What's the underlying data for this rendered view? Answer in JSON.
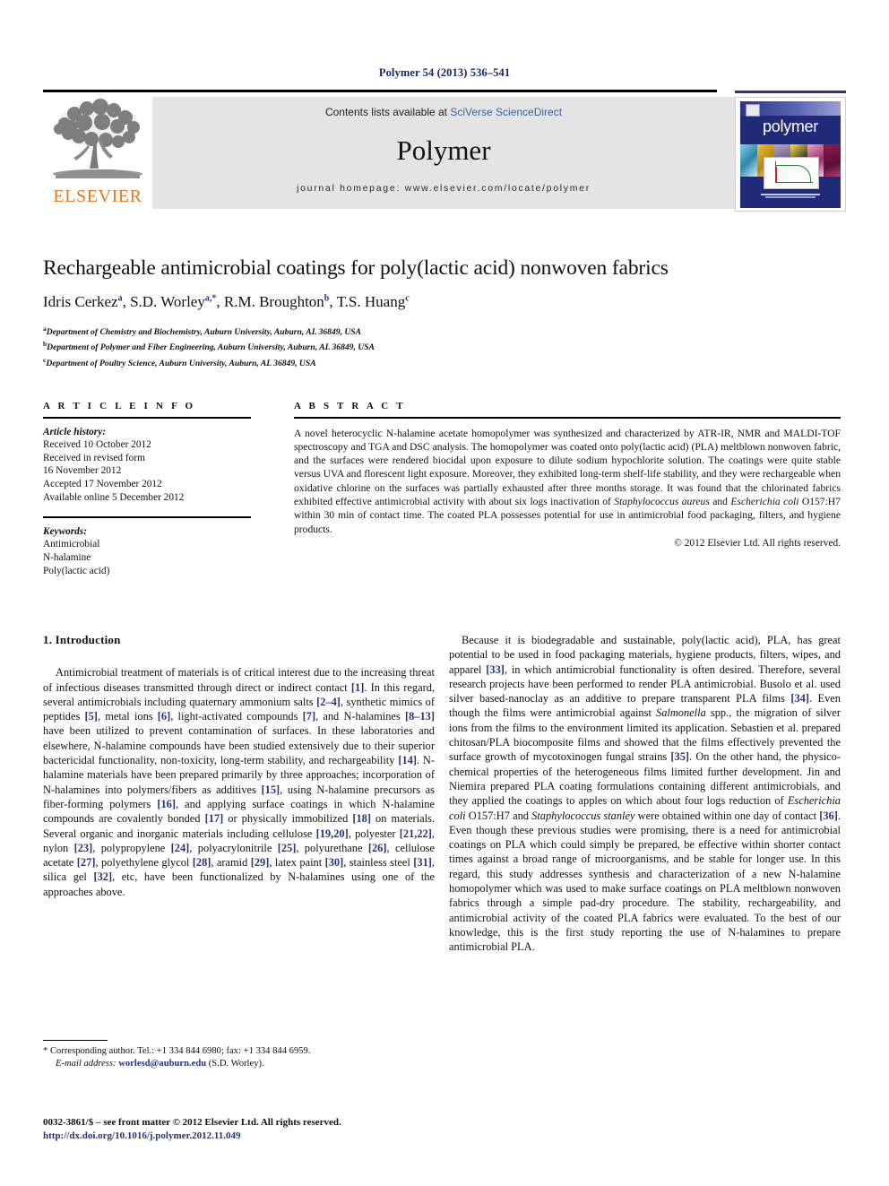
{
  "running_head": "Polymer 54 (2013) 536–541",
  "masthead": {
    "publisher": "ELSEVIER",
    "publisher_logo": "elsevier-tree-logo",
    "contents_prefix": "Contents lists available at ",
    "contents_link": "SciVerse ScienceDirect",
    "journal_name": "Polymer",
    "homepage": "journal homepage: www.elsevier.com/locate/polymer",
    "cover": {
      "title": "polymer",
      "brand_color": "#212a78"
    }
  },
  "article": {
    "title": "Rechargeable antimicrobial coatings for poly(lactic acid) nonwoven fabrics",
    "authors": [
      {
        "name": "Idris Cerkez",
        "marks": "a"
      },
      {
        "name": "S.D. Worley",
        "marks": "a,*"
      },
      {
        "name": "R.M. Broughton",
        "marks": "b"
      },
      {
        "name": "T.S. Huang",
        "marks": "c"
      }
    ],
    "affiliations": [
      {
        "mark": "a",
        "text": "Department of Chemistry and Biochemistry, Auburn University, Auburn, AL 36849, USA"
      },
      {
        "mark": "b",
        "text": "Department of Polymer and Fiber Engineering, Auburn University, Auburn, AL 36849, USA"
      },
      {
        "mark": "c",
        "text": "Department of Poultry Science, Auburn University, Auburn, AL 36849, USA"
      }
    ]
  },
  "article_info": {
    "heading": "A R T I C L E   I N F O",
    "history_label": "Article history:",
    "history": [
      "Received 10 October 2012",
      "Received in revised form",
      "16 November 2012",
      "Accepted 17 November 2012",
      "Available online 5 December 2012"
    ],
    "keywords_label": "Keywords:",
    "keywords": [
      "Antimicrobial",
      "N-halamine",
      "Poly(lactic acid)"
    ]
  },
  "abstract": {
    "heading": "A B S T R A C T",
    "paragraph_1": "A novel heterocyclic N-halamine acetate homopolymer was synthesized and characterized by ATR-IR, NMR and MALDI-TOF spectroscopy and TGA and DSC analysis. The homopolymer was coated onto poly(lactic acid) (PLA) meltblown nonwoven fabric, and the surfaces were rendered biocidal upon exposure to dilute sodium hypochlorite solution. The coatings were quite stable versus UVA and florescent light exposure. Moreover, they exhibited long-term shelf-life stability, and they were rechargeable when oxidative chlorine on the surfaces was partially exhausted after three months storage. It was found that the chlorinated fabrics exhibited effective antimicrobial activity with about six logs inactivation of ",
    "italic_1": "Staphylococcus aureus",
    "mid_1": " and ",
    "italic_2": "Escherichia coli",
    "tail_1": " O157:H7 within 30 min of contact time. The coated PLA possesses potential for use in antimicrobial food packaging, filters, and hygiene products.",
    "copyright": "© 2012 Elsevier Ltd. All rights reserved."
  },
  "introduction": {
    "heading": "1. Introduction",
    "left_p1_a": "Antimicrobial treatment of materials is of critical interest due to the increasing threat of infectious diseases transmitted through direct or indirect contact ",
    "left_refs": {
      "r1": "[1]",
      "r2_4": "[2–4]",
      "r5": "[5]",
      "r6": "[6]",
      "r7": "[7]",
      "r8_13": "[8–13]",
      "r14": "[14]",
      "r15": "[15]",
      "r16": "[16]",
      "r17": "[17]",
      "r18": "[18]",
      "r19_20": "[19,20]",
      "r21_22": "[21,22]",
      "r23": "[23]",
      "r24": "[24]",
      "r25": "[25]",
      "r26": "[26]",
      "r27": "[27]",
      "r28": "[28]",
      "r29": "[29]",
      "r30": "[30]",
      "r31": "[31]",
      "r32": "[32]"
    },
    "left_p1_b": ". In this regard, several antimicrobials including quaternary ammonium salts ",
    "left_p1_c": ", synthetic mimics of peptides ",
    "left_p1_d": ", metal ions ",
    "left_p1_e": ", light-activated compounds ",
    "left_p1_f": ", and N-halamines ",
    "left_p1_g": " have been utilized to prevent contamination of surfaces. In these laboratories and elsewhere, N-halamine compounds have been studied extensively due to their superior bactericidal functionality, non-toxicity, long-term stability, and rechargeability ",
    "left_p1_h": ". N-halamine materials have been prepared primarily by three approaches; incorporation of N-halamines into polymers/fibers as additives ",
    "left_p1_i": ", using N-halamine precursors as fiber-forming polymers ",
    "left_p1_j": ", and applying surface coatings in which N-halamine compounds are covalently bonded ",
    "left_p1_k": " or physically immobilized ",
    "left_p1_l": " on materials. Several organic and inorganic materials including cellulose ",
    "left_p1_m": ", polyester ",
    "left_p1_n": ", nylon ",
    "left_p1_o": ", polypropylene ",
    "left_p1_p": ", polyacrylonitrile ",
    "left_p1_q": ", polyurethane ",
    "left_p1_r": ", cellulose acetate ",
    "left_p1_s": ", polyethylene glycol ",
    "left_p1_t": ", aramid ",
    "left_p1_u": ", latex paint ",
    "left_p1_v": ", stainless steel ",
    "left_p1_w": ", silica gel ",
    "left_p1_x": ", etc, have been functionalized by N-halamines using one of the approaches above.",
    "right_refs": {
      "r33": "[33]",
      "r34": "[34]",
      "r35": "[35]",
      "r36": "[36]"
    },
    "right_p1_a": "Because it is biodegradable and sustainable, poly(lactic acid), PLA, has great potential to be used in food packaging materials, hygiene products, filters, wipes, and apparel ",
    "right_p1_b": ", in which antimicrobial functionality is often desired. Therefore, several research projects have been performed to render PLA antimicrobial. Busolo et al. used silver based-nanoclay as an additive to prepare transparent PLA films ",
    "right_p1_c": ". Even though the films were antimicrobial against ",
    "right_italic_1": "Salmonella",
    "right_p1_d": " spp., the migration of silver ions from the films to the environment limited its application. Sebastien et al. prepared chitosan/PLA biocomposite films and showed that the films effectively prevented the surface growth of mycotoxinogen fungal strains ",
    "right_p1_e": ". On the other hand, the physico-chemical properties of the heterogeneous films limited further development. Jin and Niemira prepared PLA coating formulations containing different antimicrobials, and they applied the coatings to apples on which about four logs reduction of ",
    "right_italic_2": "Escherichia coli",
    "right_p1_f": " O157:H7 and ",
    "right_italic_3": "Staphylococcus stanley",
    "right_p1_g": " were obtained within one day of contact ",
    "right_p1_h": ". Even though these previous studies were promising, there is a need for antimicrobial coatings on PLA which could simply be prepared, be effective within shorter contact times against a broad range of microorganisms, and be stable for longer use. In this regard, this study addresses synthesis and characterization of a new N-halamine homopolymer which was used to make surface coatings on PLA meltblown nonwoven fabrics through a simple pad-dry procedure. The stability, rechargeability, and antimicrobial activity of the coated PLA fabrics were evaluated. To the best of our knowledge, this is the first study reporting the use of N-halamines to prepare antimicrobial PLA."
  },
  "footnote": {
    "line1": "* Corresponding author. Tel.: +1 334 844 6980; fax: +1 334 844 6959.",
    "email_label": "E-mail address:",
    "email": "worlesd@auburn.edu",
    "email_suffix": " (S.D. Worley)."
  },
  "footer": {
    "issn_line": "0032-3861/$ – see front matter © 2012 Elsevier Ltd. All rights reserved.",
    "doi": "http://dx.doi.org/10.1016/j.polymer.2012.11.049"
  }
}
